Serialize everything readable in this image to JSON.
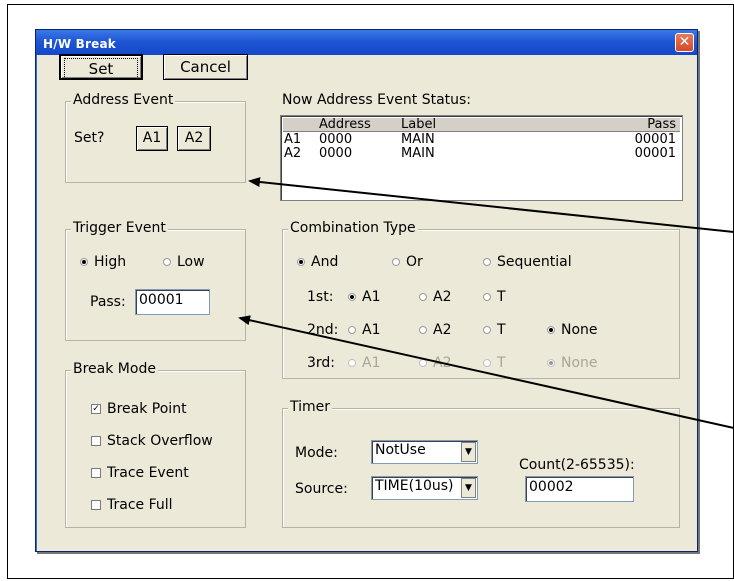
{
  "dialog": {
    "title": "H/W Break",
    "close_glyph": "✕",
    "set_label": "Set",
    "cancel_label": "Cancel"
  },
  "address_event": {
    "group_label": "Address Event",
    "set_prompt": "Set?",
    "a1_label": "A1",
    "a2_label": "A2"
  },
  "status": {
    "label": "Now Address Event Status:",
    "columns": [
      "Address",
      "Label",
      "Pass"
    ],
    "rows": [
      {
        "id": "A1",
        "address": "0000",
        "label": "MAIN",
        "pass": "00001"
      },
      {
        "id": "A2",
        "address": "0000",
        "label": "MAIN",
        "pass": "00001"
      }
    ]
  },
  "trigger_event": {
    "group_label": "Trigger Event",
    "high_label": "High",
    "low_label": "Low",
    "selected": "High",
    "pass_label": "Pass:",
    "pass_value": "00001"
  },
  "combination": {
    "group_label": "Combination Type",
    "types": [
      "And",
      "Or",
      "Sequential"
    ],
    "selected_type": "And",
    "first_label": "1st:",
    "second_label": "2nd:",
    "third_label": "3rd:",
    "option_a1": "A1",
    "option_a2": "A2",
    "option_t": "T",
    "option_none": "None",
    "first_selected": "A1",
    "second_selected": "None",
    "third_selected": "None"
  },
  "break_mode": {
    "group_label": "Break Mode",
    "options": [
      {
        "label": "Break Point",
        "checked": true
      },
      {
        "label": "Stack Overflow",
        "checked": false
      },
      {
        "label": "Trace Event",
        "checked": false
      },
      {
        "label": "Trace Full",
        "checked": false
      }
    ],
    "check_glyph": "✓"
  },
  "timer": {
    "group_label": "Timer",
    "mode_label": "Mode:",
    "mode_value": "NotUse",
    "source_label": "Source:",
    "source_value": "TIME(10us)",
    "count_label": "Count(2-65535):",
    "count_value": "00002",
    "dropdown_glyph": "▼"
  },
  "colors": {
    "title_bar": "#1f56d4",
    "dialog_bg": "#ece9d8",
    "close_button": "#d6472a"
  }
}
